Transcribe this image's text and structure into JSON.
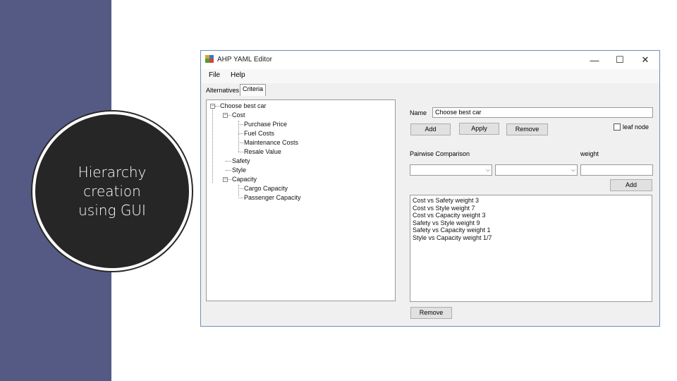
{
  "slide": {
    "caption_lines": [
      "Hierarchy",
      "creation",
      "using GUI"
    ],
    "band_color": "#555a85",
    "circle_color": "#262626"
  },
  "window": {
    "title": "AHP YAML Editor",
    "icon": "app-icon",
    "controls": {
      "minimize": "—",
      "maximize": "☐",
      "close": "✕"
    }
  },
  "menu": {
    "file": "File",
    "help": "Help"
  },
  "tabs": {
    "alternatives": "Alternatives",
    "criteria": "Criteria"
  },
  "tree": {
    "root": "Choose best car",
    "cost": "Cost",
    "purchase_price": "Purchase Price",
    "fuel_costs": "Fuel Costs",
    "maintenance_costs": "Maintenance Costs",
    "resale_value": "Resale Value",
    "safety": "Safety",
    "style": "Style",
    "capacity": "Capacity",
    "cargo_capacity": "Cargo Capacity",
    "passenger_capacity": "Passenger Capacity"
  },
  "form": {
    "name_label": "Name",
    "name_value": "Choose best car",
    "add_label": "Add",
    "apply_label": "Apply",
    "remove_label": "Remove",
    "leaf_node_label": "leaf node",
    "leaf_node_checked": false,
    "pairwise_label": "Pairwise Comparison",
    "weight_label": "weight",
    "weight_value": "",
    "combo1_value": "",
    "combo2_value": "",
    "add_comparison_label": "Add",
    "remove_comparison_label": "Remove"
  },
  "comparisons": [
    "Cost vs Safety weight 3",
    "Cost vs Style weight 7",
    "Cost vs Capacity weight 3",
    "Safety vs Style weight 9",
    "Safety vs Capacity weight 1",
    "Style vs Capacity weight 1/7"
  ]
}
